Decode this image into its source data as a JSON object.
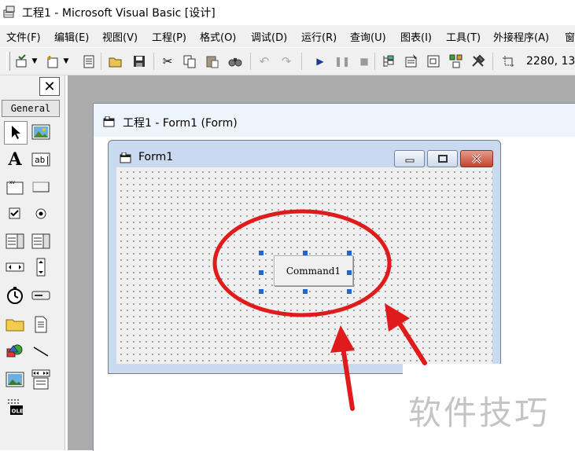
{
  "window": {
    "title": "工程1 - Microsoft Visual Basic [设计]"
  },
  "menu": [
    {
      "label": "文件(F)"
    },
    {
      "label": "编辑(E)"
    },
    {
      "label": "视图(V)"
    },
    {
      "label": "工程(P)"
    },
    {
      "label": "格式(O)"
    },
    {
      "label": "调试(D)"
    },
    {
      "label": "运行(R)"
    },
    {
      "label": "查询(U)"
    },
    {
      "label": "图表(I)"
    },
    {
      "label": "工具(T)"
    },
    {
      "label": "外接程序(A)"
    },
    {
      "label": "窗"
    }
  ],
  "toolbar": {
    "coordinates": "2280, 13"
  },
  "toolbox": {
    "close_label": "✕",
    "tab_label": "General"
  },
  "designer": {
    "title": "工程1 - Form1 (Form)"
  },
  "form": {
    "title": "Form1",
    "command_button_caption": "Command1"
  },
  "watermark": {
    "text": "软件技巧"
  },
  "colors": {
    "annotation_red": "#e01b1b",
    "selection_handle": "#1f66c9",
    "form_frame": "#c9d9ee"
  }
}
